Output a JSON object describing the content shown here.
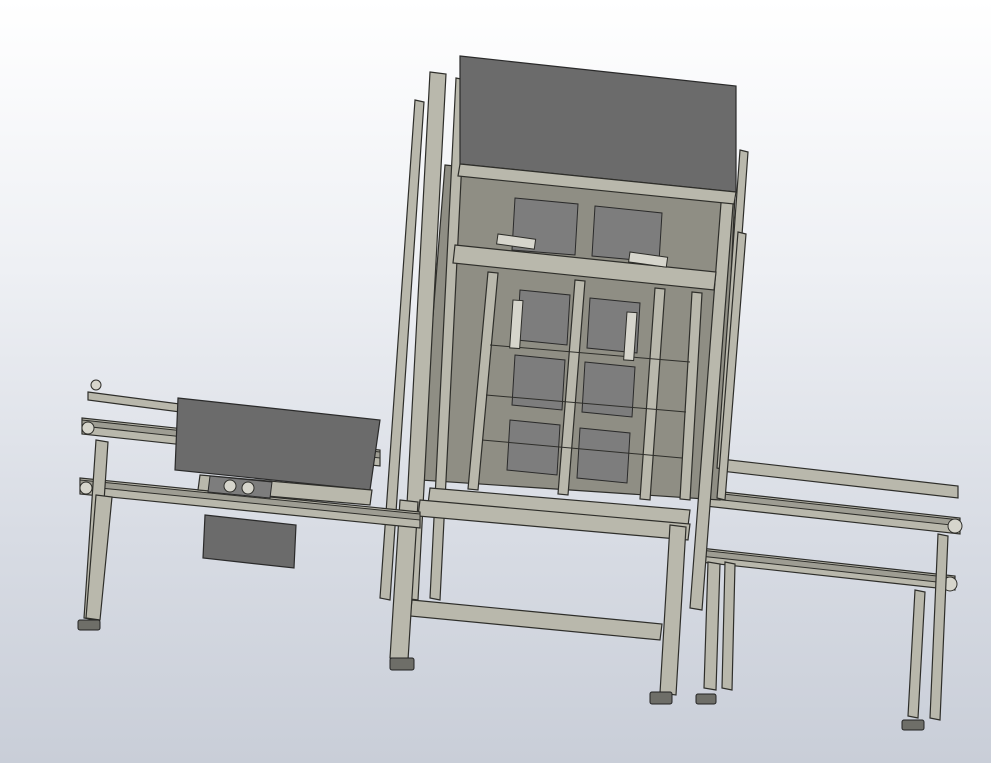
{
  "viewport": {
    "background_top": "#ffffff",
    "background_bottom": "#c9ced8",
    "frame_color": "#b9b8ac",
    "panel_color": "#6b6b6b",
    "edge_color": "#2e2e2a"
  }
}
